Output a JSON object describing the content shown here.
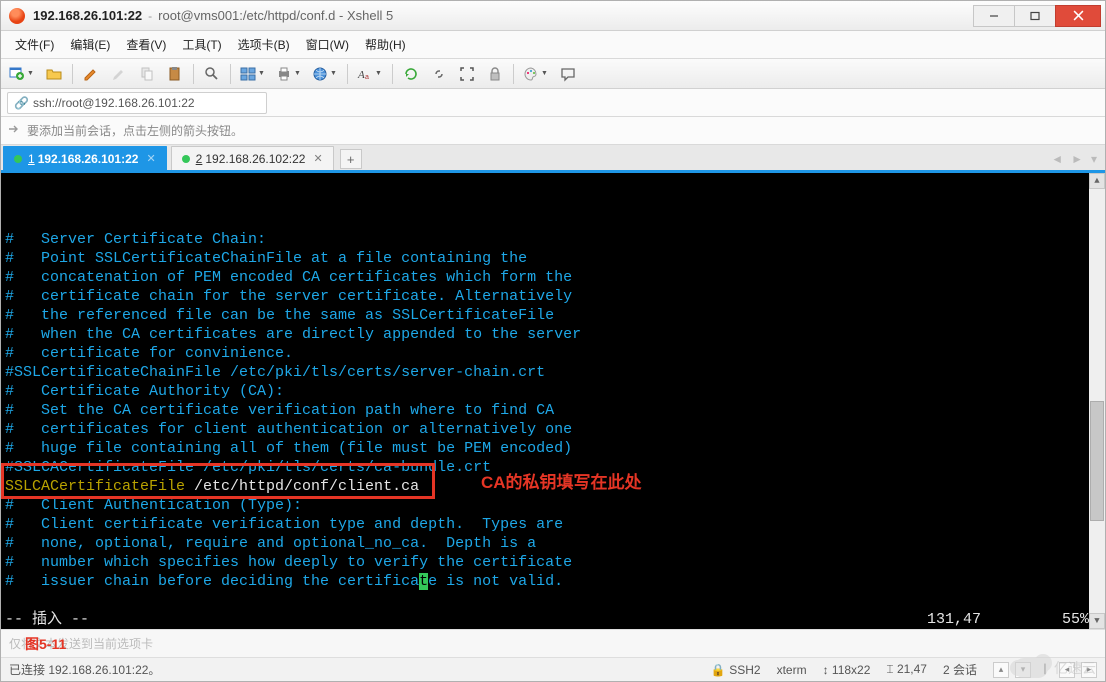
{
  "title": {
    "host": "192.168.26.101:22",
    "path": "root@vms001:/etc/httpd/conf.d - Xshell 5"
  },
  "menu": {
    "file": "文件(F)",
    "edit": "编辑(E)",
    "view": "查看(V)",
    "tools": "工具(T)",
    "tab": "选项卡(B)",
    "window": "窗口(W)",
    "help": "帮助(H)"
  },
  "toolbar_icons": {
    "new_session": "new-session-icon",
    "open": "open-icon",
    "pencil": "pencil-icon",
    "marker": "marker-icon",
    "copy": "copy-icon",
    "paste": "paste-icon",
    "search": "search-icon",
    "layout": "layout-icon",
    "globe": "globe-icon",
    "font": "font-icon",
    "refresh": "refresh-icon",
    "link": "link-icon",
    "fullscreen": "fullscreen-icon",
    "lock": "lock-icon",
    "palette": "palette-icon",
    "chat": "chat-icon"
  },
  "address": "ssh://root@192.168.26.101:22",
  "hint": "要添加当前会话，点击左侧的箭头按钮。",
  "tabs": [
    {
      "num": "1",
      "label": "192.168.26.101:22",
      "active": true
    },
    {
      "num": "2",
      "label": "192.168.26.102:22",
      "active": false
    }
  ],
  "terminal_lines": [
    "#   Server Certificate Chain:",
    "#   Point SSLCertificateChainFile at a file containing the",
    "#   concatenation of PEM encoded CA certificates which form the",
    "#   certificate chain for the server certificate. Alternatively",
    "#   the referenced file can be the same as SSLCertificateFile",
    "#   when the CA certificates are directly appended to the server",
    "#   certificate for convinience.",
    "#SSLCertificateChainFile /etc/pki/tls/certs/server-chain.crt",
    "",
    "#   Certificate Authority (CA):",
    "#   Set the CA certificate verification path where to find CA",
    "#   certificates for client authentication or alternatively one",
    "#   huge file containing all of them (file must be PEM encoded)",
    "#SSLCACertificateFile /etc/pki/tls/certs/ca-bundle.crt"
  ],
  "ssl_directive": "SSLCACertificateFile",
  "ssl_path": " /etc/httpd/conf/client.ca",
  "annotation_label": "CA的私钥填写在此处",
  "terminal_lines2": [
    "",
    "#   Client Authentication (Type):",
    "#   Client certificate verification type and depth.  Types are",
    "#   none, optional, require and optional_no_ca.  Depth is a",
    "#   number which specifies how deeply to verify the certificate"
  ],
  "cursor_line": {
    "before": "#   issuer chain before deciding the certifica",
    "cursor": "t",
    "after": "e is not valid."
  },
  "vim_status": {
    "mode": "-- 插入 --",
    "pos": "131,47",
    "pct": "55%"
  },
  "fig_label": "图5-11",
  "input_placeholder": "仅将文本发送到当前选项卡",
  "statusbar": {
    "connected": "已连接 192.168.26.101:22。",
    "proto": "SSH2",
    "term": "xterm",
    "size": "118x22",
    "cursor": "21,47",
    "sessions": "2 会话"
  },
  "watermark": "亿速云"
}
